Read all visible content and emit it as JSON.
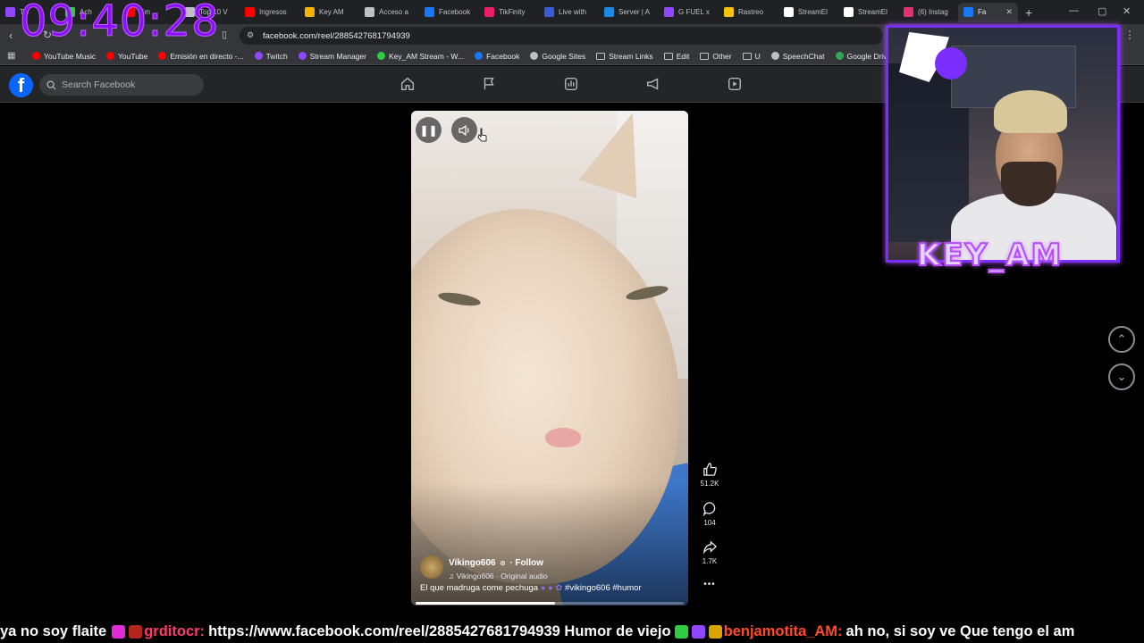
{
  "browser": {
    "tabs": [
      {
        "label": "Tw",
        "color": "#9146ff"
      },
      {
        "label": "Ach",
        "color": "#2ecc40"
      },
      {
        "label": "Em",
        "color": "#ff0000"
      },
      {
        "label": "Top 10 V",
        "color": "#bdc1c6"
      },
      {
        "label": "Ingresos",
        "color": "#ff0000"
      },
      {
        "label": "Key AM",
        "color": "#f4b400"
      },
      {
        "label": "Acceso a",
        "color": "#bdc1c6"
      },
      {
        "label": "Facebook",
        "color": "#1877f2"
      },
      {
        "label": "TikFinity",
        "color": "#e91e63"
      },
      {
        "label": "Live with",
        "color": "#3b5bdb"
      },
      {
        "label": "Server | A",
        "color": "#1e88e5"
      },
      {
        "label": "G FUEL x",
        "color": "#9146ff"
      },
      {
        "label": "Rastreo",
        "color": "#f4c20d"
      },
      {
        "label": "StreamEl",
        "color": "#ffffff"
      },
      {
        "label": "StreamEl",
        "color": "#ffffff"
      },
      {
        "label": "(6) Instag",
        "color": "#e1306c"
      },
      {
        "label": "Fa",
        "color": "#1877f2",
        "active": true
      }
    ],
    "url": "facebook.com/reel/2885427681794939",
    "bookmarks": [
      {
        "label": "YouTube Music",
        "color": "#ff0000"
      },
      {
        "label": "YouTube",
        "color": "#ff0000"
      },
      {
        "label": "Emisión en directo -...",
        "color": "#ff0000"
      },
      {
        "label": "Twitch",
        "color": "#9146ff"
      },
      {
        "label": "Stream Manager",
        "color": "#9146ff"
      },
      {
        "label": "Key_AM Stream - W...",
        "color": "#2ecc40"
      },
      {
        "label": "Facebook",
        "color": "#1877f2"
      },
      {
        "label": "Google Sites",
        "color": "#bdc1c6"
      },
      {
        "label": "Stream Links",
        "folder": true
      },
      {
        "label": "Edit",
        "folder": true
      },
      {
        "label": "Other",
        "folder": true
      },
      {
        "label": "U",
        "folder": true
      },
      {
        "label": "SpeechChat",
        "color": "#bdc1c6"
      },
      {
        "label": "Google Drive",
        "color": "#34a853"
      }
    ]
  },
  "facebook": {
    "search_placeholder": "Search Facebook",
    "reel": {
      "author": "Vikingo606",
      "follow": "· Follow",
      "audio": "♫ Vikingo606 · Original audio",
      "caption": "El que madruga come pechuga",
      "hashtags": "#vikingo606 #humor",
      "likes": "51.2K",
      "comments": "104",
      "shares": "1.7K",
      "more": "•••",
      "progress": 0.52
    }
  },
  "overlay": {
    "clock": "09:40:28",
    "cam_name": "KEY_AM",
    "ticker": {
      "part1": "ya no soy flaite",
      "user1": "grditocr:",
      "part2": "https://www.facebook.com/reel/2885427681794939 Humor de viejo",
      "user2": "benjamotita_AM:",
      "part3": "ah no, si soy ve Que tengo el am"
    }
  }
}
